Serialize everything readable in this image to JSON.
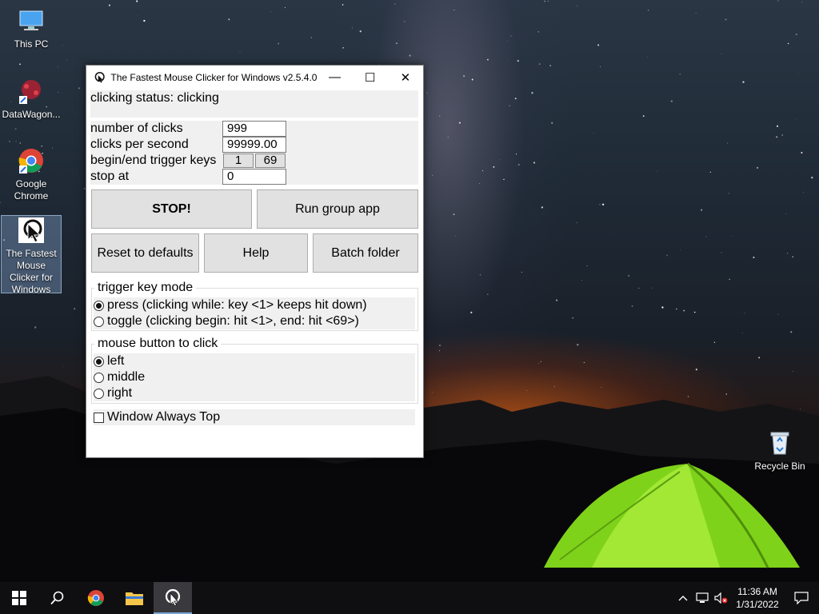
{
  "desktop": {
    "icons": [
      {
        "label": "This PC"
      },
      {
        "label": "DataWagon..."
      },
      {
        "label": "Google Chrome"
      },
      {
        "label": "The Fastest Mouse Clicker for Windows"
      },
      {
        "label": "Recycle Bin"
      }
    ]
  },
  "window": {
    "title": "The Fastest Mouse Clicker for Windows v2.5.4.0",
    "controls": {
      "minimize": "—",
      "maximize": "☐",
      "close": "✕"
    },
    "status": "clicking status: clicking",
    "settings": {
      "num_clicks_label": "number of clicks",
      "num_clicks_value": "999",
      "cps_label": "clicks per second",
      "cps_value": "99999.00",
      "trigger_keys_label": "begin/end trigger keys",
      "begin_key": "1",
      "end_key": "69",
      "stop_at_label": "stop at",
      "stop_at_value": "0"
    },
    "buttons": {
      "stop": "STOP!",
      "run_group": "Run group app",
      "reset": "Reset to defaults",
      "help": "Help",
      "batch_folder": "Batch folder"
    },
    "trigger_mode": {
      "title": "trigger key mode",
      "options": [
        {
          "label": "press (clicking while: key <1> keeps hit down)",
          "selected": true
        },
        {
          "label": "toggle (clicking begin: hit <1>, end: hit <69>)",
          "selected": false
        }
      ]
    },
    "mouse_button": {
      "title": "mouse button to click",
      "options": [
        {
          "label": "left",
          "selected": true
        },
        {
          "label": "middle",
          "selected": false
        },
        {
          "label": "right",
          "selected": false
        }
      ]
    },
    "always_top": {
      "label": "Window Always Top",
      "checked": false
    }
  },
  "taskbar": {
    "time": "11:36 AM",
    "date": "1/31/2022"
  }
}
